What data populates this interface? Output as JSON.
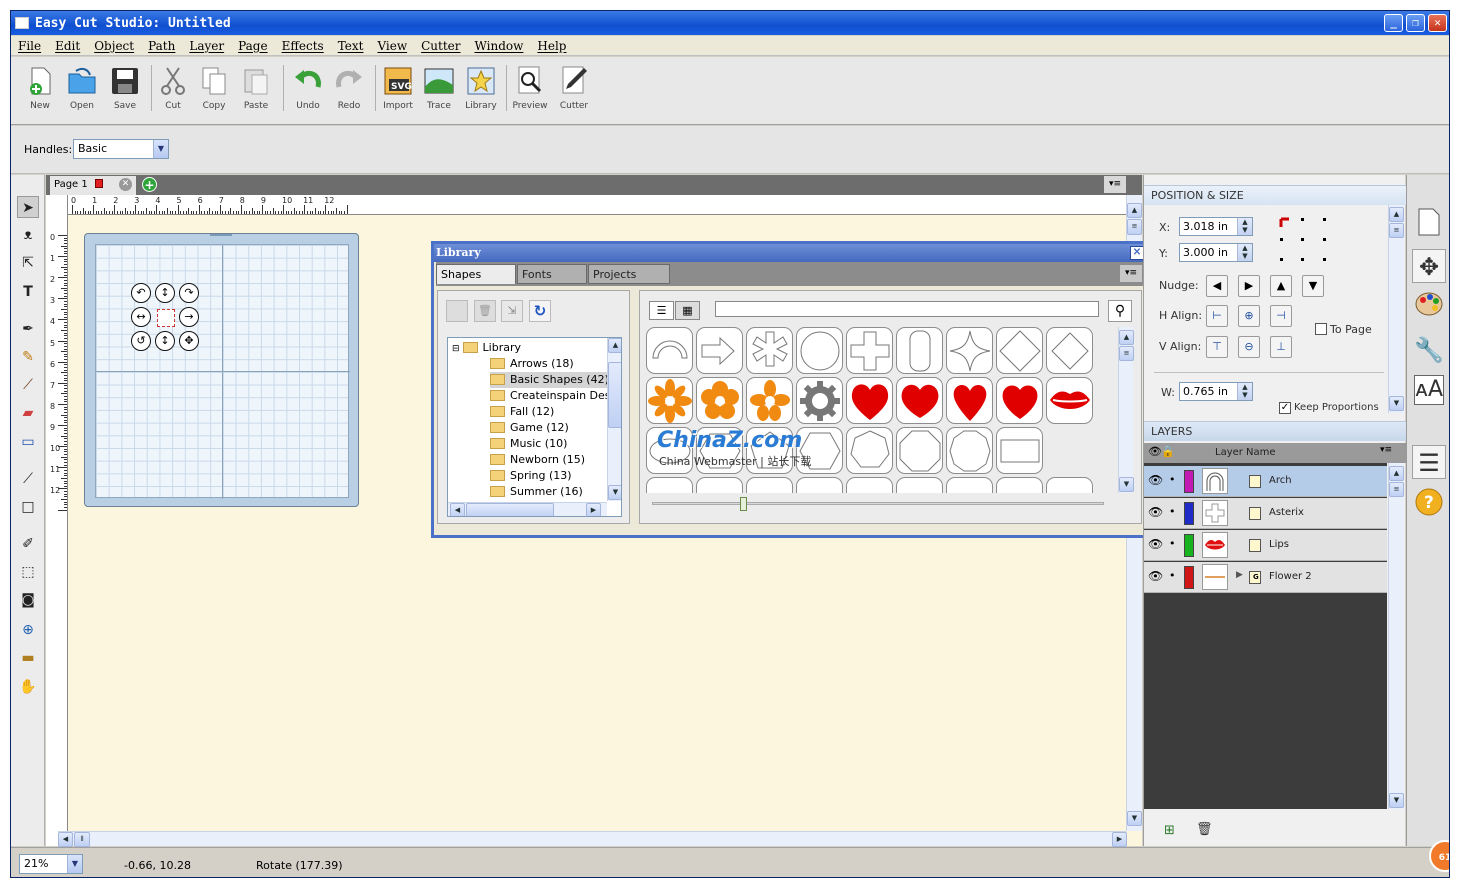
{
  "window": {
    "title": "Easy Cut Studio: Untitled"
  },
  "menu": [
    "File",
    "Edit",
    "Object",
    "Path",
    "Layer",
    "Page",
    "Effects",
    "Text",
    "View",
    "Cutter",
    "Window",
    "Help"
  ],
  "toolbar": {
    "new": "New",
    "open": "Open",
    "save": "Save",
    "cut": "Cut",
    "copy": "Copy",
    "paste": "Paste",
    "undo": "Undo",
    "redo": "Redo",
    "import": "Import",
    "trace": "Trace",
    "library": "Library",
    "preview": "Preview",
    "cutter": "Cutter"
  },
  "options": {
    "handles_label": "Handles:",
    "handles_value": "Basic"
  },
  "page": {
    "tab_label": "Page 1"
  },
  "ruler": {
    "h": [
      "0",
      "1",
      "2",
      "3",
      "4",
      "5",
      "6",
      "7",
      "8",
      "9",
      "10",
      "11",
      "12"
    ],
    "v": [
      "0",
      "1",
      "2",
      "3",
      "4",
      "5",
      "6",
      "7",
      "8",
      "9",
      "10",
      "11",
      "12"
    ]
  },
  "library": {
    "title": "Library",
    "tabs": [
      "Shapes",
      "Fonts",
      "Projects"
    ],
    "search_value": "",
    "tree": {
      "root": "Library",
      "folders": [
        "Arrows (18)",
        "Basic Shapes (42)",
        "Createinspain Desi",
        "Fall (12)",
        "Game (12)",
        "Music (10)",
        "Newborn (15)",
        "Spring (13)",
        "Summer (16)"
      ],
      "selected": "Basic Shapes (42)"
    },
    "shapes_row1": [
      "arch",
      "arrow-right",
      "asterisk",
      "circle",
      "cross",
      "rounded-rect",
      "star-4-point",
      "diamond",
      "diamond-small"
    ],
    "shapes_row2": [
      "flower-1",
      "flower-2",
      "flower-3",
      "gear",
      "heart-1",
      "heart-2",
      "heart-3",
      "heart-4",
      "lips"
    ],
    "shapes_row3": [
      "oval",
      "hexagon-small",
      "pentagon",
      "hexagon",
      "heptagon",
      "octagon",
      "decagon",
      "rectangle"
    ],
    "zoom_level": 0.2
  },
  "watermark": {
    "logo": "ChinaZ.com",
    "line": "China Webmaster | 站长下载"
  },
  "position_size": {
    "header": "POSITION & SIZE",
    "x_label": "X:",
    "x_value": "3.018 in",
    "y_label": "Y:",
    "y_value": "3.000 in",
    "nudge_label": "Nudge:",
    "halign_label": "H Align:",
    "valign_label": "V Align:",
    "to_page_label": "To Page",
    "w_label": "W:",
    "w_value": "0.765 in",
    "keep_proportions_label": "Keep Proportions"
  },
  "layers": {
    "header": "LAYERS",
    "column_name": "Layer Name",
    "items": [
      {
        "name": "Arch",
        "color": "#c21bb4"
      },
      {
        "name": "Asterix",
        "color": "#1f2cc8"
      },
      {
        "name": "Lips",
        "color": "#18b31e"
      },
      {
        "name": "Flower 2",
        "color": "#d01616"
      }
    ]
  },
  "status": {
    "zoom": "21%",
    "coords": "-0.66, 10.28",
    "action": "Rotate (177.39)",
    "badge": "61"
  }
}
